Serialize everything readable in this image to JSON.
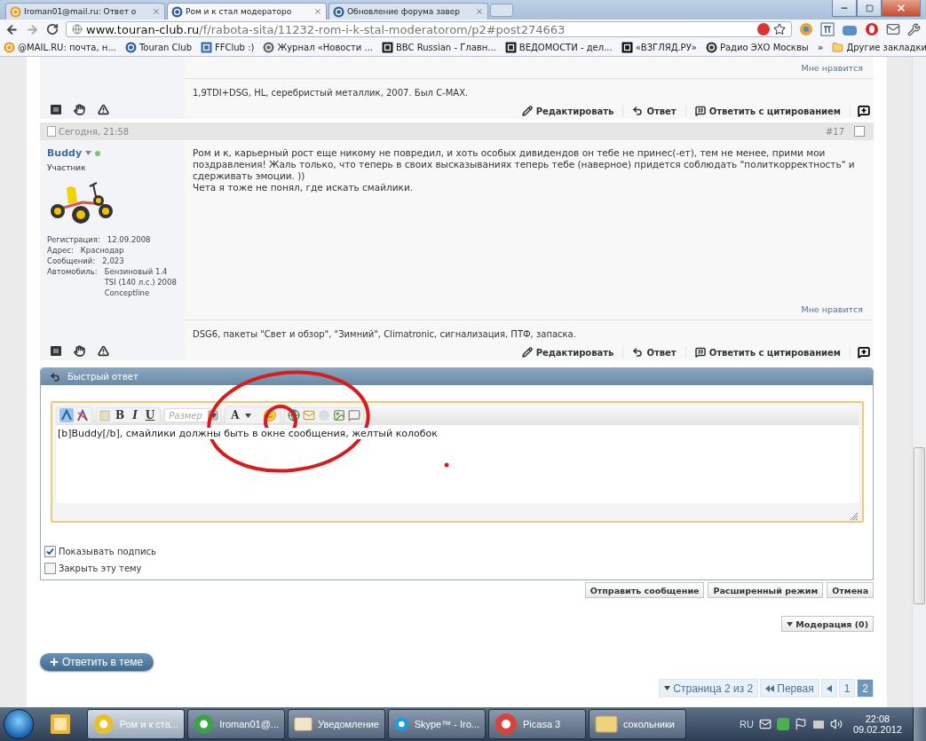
{
  "browser": {
    "tabs": [
      {
        "label": "Iroman01@mail.ru: Ответ о",
        "kind": "mail",
        "selected": false
      },
      {
        "label": "Ром и к стал модераторо",
        "kind": "vw",
        "selected": true
      },
      {
        "label": "Обновление форума завер",
        "kind": "vw",
        "selected": false
      }
    ],
    "url_host": "www.touran-club.ru",
    "url_path": "/f/rabota-sita/11232-rom-i-k-stal-moderatorom/p2#post274663",
    "bookmarks": [
      {
        "label": "@MAIL.RU: почта, н...",
        "kind": "mail"
      },
      {
        "label": "Touran Club",
        "kind": "vw"
      },
      {
        "label": "FFClub :)",
        "kind": "ff"
      },
      {
        "label": "Журнал «Новости ...",
        "kind": "journal"
      },
      {
        "label": "BBC Russian - Главн...",
        "kind": "bbc"
      },
      {
        "label": "ВЕДОМОСТИ - дел...",
        "kind": "vedomosti"
      },
      {
        "label": "«ВЗГЛЯД.РУ»",
        "kind": "vzglyad"
      },
      {
        "label": "Радио ЭХО Москвы",
        "kind": "echo"
      }
    ],
    "more": "»",
    "other_bookmarks": "Другие закладки"
  },
  "previous_post": {
    "like": "Мне нравится",
    "signature": "1,9TDI+DSG, HL, серебристый металлик, 2007. Был C-MAX.",
    "actions": [
      {
        "kind": "edit",
        "label": "Редактировать"
      },
      {
        "kind": "reply",
        "label": "Ответ"
      },
      {
        "kind": "quote",
        "label": "Ответить с цитированием"
      }
    ]
  },
  "post": {
    "date": "Сегодня, 21:58",
    "number": "#17",
    "selected": false,
    "author": "Buddy",
    "online": true,
    "role": "Участник",
    "info": [
      {
        "label": "Регистрация:",
        "value": "12.09.2008"
      },
      {
        "label": "Адрес:",
        "value": "Краснодар"
      },
      {
        "label": "Сообщений:",
        "value": "2,023"
      },
      {
        "label": "Автомобиль:",
        "value": "Бензиновый 1.4 TSI (140 л.с.) 2008 Conceptline"
      }
    ],
    "message": [
      "Ром и к, карьерный рост еще никому не повредил, и хоть особых дивидендов он тебе не принес(-ет), тем не менее, прими мои поздравления! Жаль только, что теперь в своих высказываниях теперь тебе (наверное) придется соблюдать \"политкорректность\" и сдерживать эмоции. ))",
      "Чета я тоже не понял, где искать смайлики."
    ],
    "like": "Мне нравится",
    "signature": "DSG6, пакеты \"Свет и обзор\", \"Зимний\", Climatronic, сигнализация, ПТФ, запаска.",
    "actions": [
      {
        "kind": "edit",
        "label": "Редактировать"
      },
      {
        "kind": "reply",
        "label": "Ответ"
      },
      {
        "kind": "quote",
        "label": "Ответить с цитированием"
      }
    ]
  },
  "quick_reply": {
    "title": "Быстрый ответ",
    "format": [
      "B",
      "I",
      "U"
    ],
    "size_placeholder": "Размер",
    "color_button": "A",
    "text": "[b]Buddy[/b], смайлики должны быть в окне сообщения, желтый колобок",
    "options": [
      {
        "label": "Показывать подпись",
        "checked": true
      },
      {
        "label": "Закрыть эту тему",
        "checked": false
      }
    ],
    "buttons": [
      "Отправить сообщение",
      "Расширенный режим",
      "Отмена"
    ]
  },
  "moderation": "Модерация (0)",
  "reply_button": "Ответить в теме",
  "pagination": {
    "label": "Страница 2 из 2",
    "first": "Первая",
    "pages": [
      {
        "label": "1",
        "selected": false
      },
      {
        "label": "2",
        "selected": true
      }
    ]
  },
  "taskbar": {
    "items": [
      {
        "kind": "chrome",
        "label": "Ром и к ста...",
        "selected": true
      },
      {
        "kind": "agent",
        "label": "Iroman01@...",
        "selected": false
      },
      {
        "kind": "mail",
        "label": "Уведомление",
        "selected": false
      },
      {
        "kind": "skype",
        "label": "Skype™ - Iro...",
        "selected": false
      },
      {
        "kind": "picasa",
        "label": "Picasa 3",
        "selected": false
      },
      {
        "kind": "folder",
        "label": "сокольники",
        "selected": false
      }
    ],
    "language": "RU",
    "time": "22:08",
    "date": "09.02.2012"
  }
}
